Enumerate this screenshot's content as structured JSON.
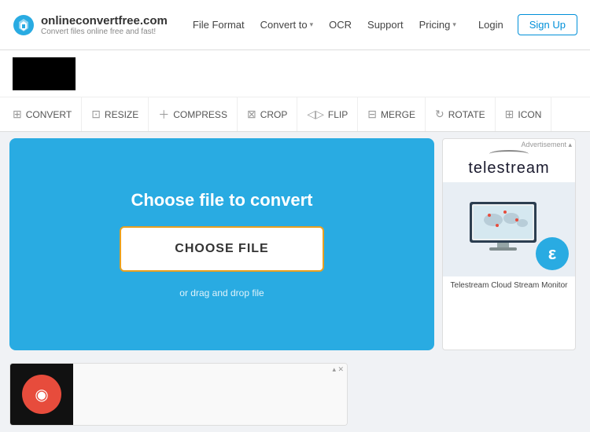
{
  "header": {
    "logo_name": "onlineconvertfree.com",
    "logo_tagline": "Convert files online free and fast!",
    "nav": [
      {
        "id": "file-format",
        "label": "File Format",
        "has_arrow": false
      },
      {
        "id": "convert-to",
        "label": "Convert to",
        "has_arrow": true
      },
      {
        "id": "ocr",
        "label": "OCR",
        "has_arrow": false
      },
      {
        "id": "support",
        "label": "Support",
        "has_arrow": false
      },
      {
        "id": "pricing",
        "label": "Pricing",
        "has_arrow": true
      }
    ],
    "login_label": "Login",
    "signup_label": "Sign Up"
  },
  "tools": [
    {
      "id": "convert",
      "label": "CONVERT",
      "icon": "⊞"
    },
    {
      "id": "resize",
      "label": "RESIZE",
      "icon": "⊡"
    },
    {
      "id": "compress",
      "label": "COMPRESS",
      "icon": "+"
    },
    {
      "id": "crop",
      "label": "CROP",
      "icon": "⊠"
    },
    {
      "id": "flip",
      "label": "FLIP",
      "icon": "◁"
    },
    {
      "id": "merge",
      "label": "MERGE",
      "icon": "⊟"
    },
    {
      "id": "rotate",
      "label": "ROTATE",
      "icon": "↻"
    },
    {
      "id": "icon",
      "label": "ICON",
      "icon": "⊞"
    }
  ],
  "convert_section": {
    "title": "Choose file to convert",
    "button_label": "CHOOSE FILE",
    "drag_drop_text": "or drag and drop file"
  },
  "ad_sidebar": {
    "brand": "telestream",
    "caption": "Telestream Cloud Stream Monitor"
  },
  "colors": {
    "primary": "#29abe2",
    "orange_border": "#e8a020",
    "signup_border": "#0090d9"
  }
}
